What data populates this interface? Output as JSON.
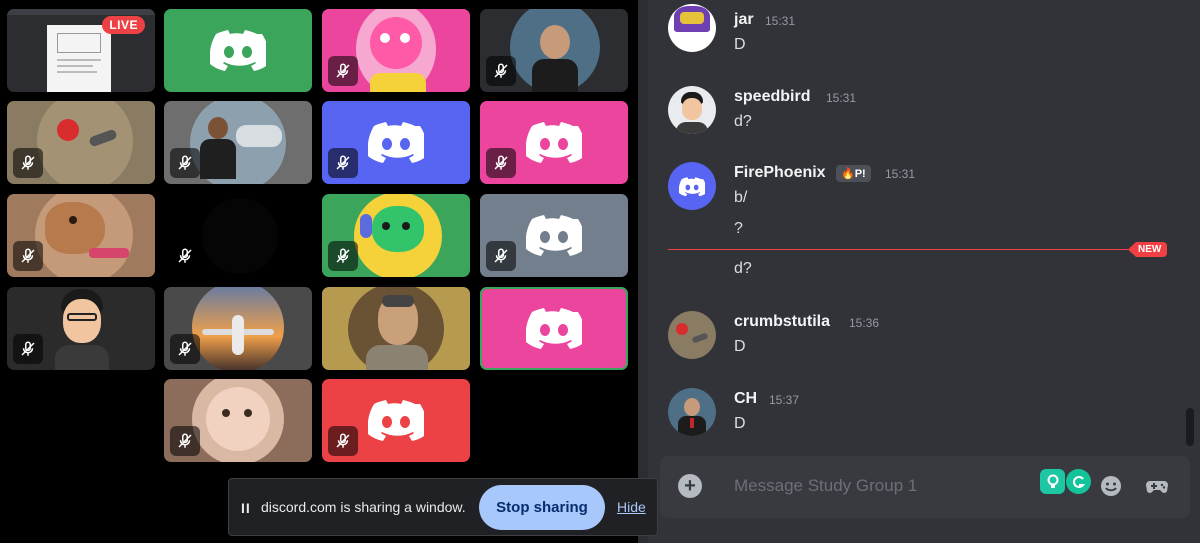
{
  "video": {
    "live_label": "LIVE",
    "tiles": [
      {
        "id": "t1",
        "type": "screenshare",
        "bg": "#2b2d31",
        "muted": false
      },
      {
        "id": "t2",
        "type": "discord",
        "bg": "#3ba55c",
        "muted": false
      },
      {
        "id": "t3",
        "type": "avatar",
        "bg": "#eb459e",
        "muted": true
      },
      {
        "id": "t4",
        "type": "avatar",
        "bg": "#2b2d31",
        "muted": true
      },
      {
        "id": "t5",
        "type": "avatar",
        "bg": "#8a7b63",
        "muted": true
      },
      {
        "id": "t6",
        "type": "avatar",
        "bg": "#6e6e6e",
        "muted": true
      },
      {
        "id": "t7",
        "type": "discord",
        "bg": "#5865f2",
        "muted": true
      },
      {
        "id": "t8",
        "type": "discord",
        "bg": "#eb459e",
        "muted": true
      },
      {
        "id": "t9",
        "type": "avatar",
        "bg": "#a07a5e",
        "muted": true
      },
      {
        "id": "t10",
        "type": "empty",
        "bg": "#000000",
        "muted": true
      },
      {
        "id": "t11",
        "type": "avatar",
        "bg": "#3ba55c",
        "muted": true
      },
      {
        "id": "t12",
        "type": "discord",
        "bg": "#747f8d",
        "muted": true
      },
      {
        "id": "t13",
        "type": "avatar",
        "bg": "#2b2b2b",
        "muted": true
      },
      {
        "id": "t14",
        "type": "avatar",
        "bg": "#4a4a4a",
        "muted": true
      },
      {
        "id": "t15",
        "type": "avatar",
        "bg": "#b69a50",
        "muted": false
      },
      {
        "id": "t16",
        "type": "discord",
        "bg": "#eb459e",
        "muted": false,
        "speaking": true
      },
      {
        "id": "t17",
        "type": "avatar",
        "bg": "#8c6d5b",
        "muted": true
      },
      {
        "id": "t18",
        "type": "discord",
        "bg": "#ed4245",
        "muted": true
      }
    ]
  },
  "share_bar": {
    "pause_glyph": "II",
    "text": "discord.com is sharing a window.",
    "stop_label": "Stop sharing",
    "hide_label": "Hide"
  },
  "chat": {
    "messages": [
      {
        "user": "jar",
        "time": "15:31",
        "lines": [
          "D"
        ]
      },
      {
        "user": "speedbird",
        "time": "15:31",
        "lines": [
          "d?"
        ]
      },
      {
        "user": "FirePhoenix",
        "badge": "🔥P!",
        "time": "15:31",
        "lines": [
          "b/",
          "?"
        ]
      },
      {
        "new_label": "NEW",
        "lines": [
          "d?"
        ]
      },
      {
        "user": "crumbstutila",
        "time": "15:36",
        "lines": [
          "D"
        ]
      },
      {
        "user": "CH",
        "time": "15:37",
        "lines": [
          "D"
        ]
      }
    ],
    "input_placeholder": "Message Study Group 1",
    "plus_glyph": "+"
  },
  "colors": {
    "blurple": "#5865f2",
    "green": "#3ba55c",
    "pink": "#eb459e",
    "red": "#ed4245",
    "grey": "#747f8d"
  }
}
